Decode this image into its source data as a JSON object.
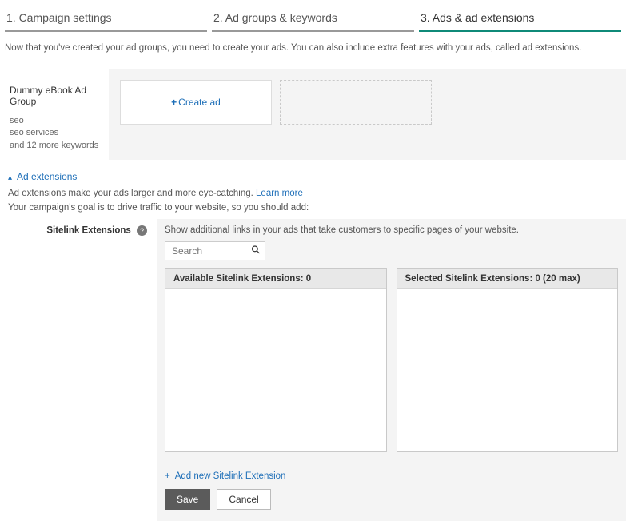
{
  "steps": {
    "s1": "1. Campaign settings",
    "s2": "2. Ad groups & keywords",
    "s3": "3. Ads & ad extensions"
  },
  "intro": "Now that you've created your ad groups, you need to create your ads. You can also include extra features with your ads, called ad extensions.",
  "adgroup": {
    "title": "Dummy eBook Ad Group",
    "line1": "seo",
    "line2": "seo services",
    "line3": "and 12 more keywords"
  },
  "create_ad": "Create ad",
  "ext": {
    "toggle": "Ad extensions",
    "desc": "Ad extensions make your ads larger and more eye-catching. ",
    "learn": "Learn more",
    "goal": "Your campaign's goal is to drive traffic to your website, so you should add:"
  },
  "sitelink": {
    "label": "Sitelink Extensions",
    "hint": "Show additional links in your ads that take customers to specific pages of your website.",
    "search_placeholder": "Search",
    "available_label": "Available Sitelink Extensions:  0",
    "selected_label": "Selected Sitelink Extensions:  0 (20 max)",
    "add_new": "Add new Sitelink Extension",
    "save": "Save",
    "cancel": "Cancel"
  }
}
